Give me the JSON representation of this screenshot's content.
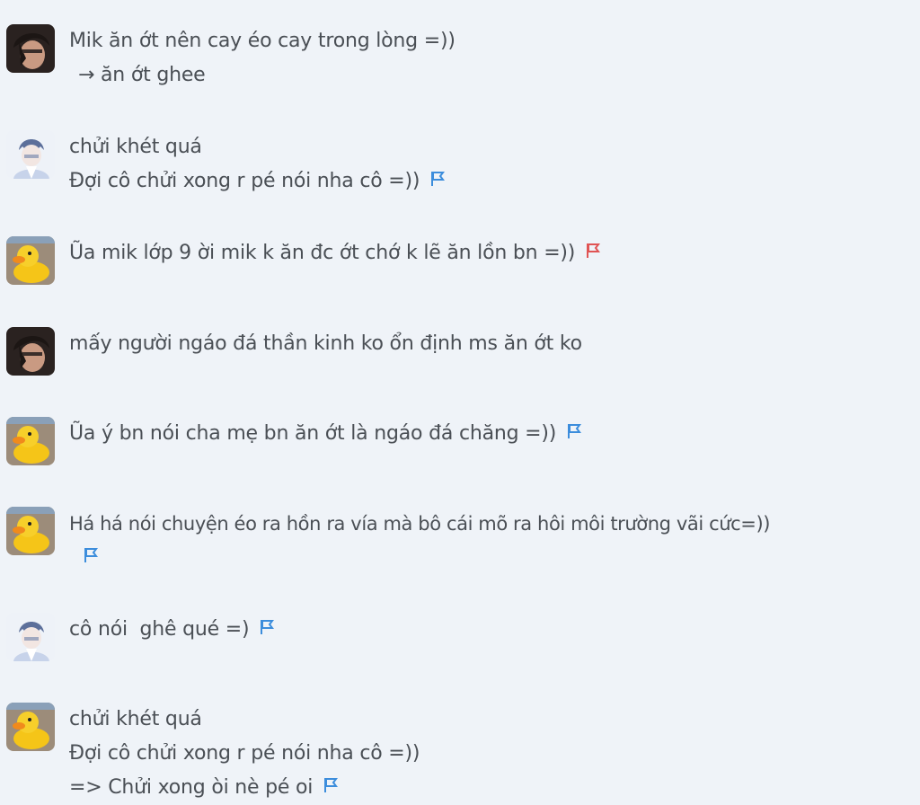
{
  "comments": [
    {
      "avatar": "dark-hair-avatar",
      "lines": [
        "Mik ăn ớt nên cay éo cay trong lòng =))",
        "→  ăn ớt ghee"
      ],
      "flag": null
    },
    {
      "avatar": "anime-boy-avatar",
      "lines": [
        "chửi khét quá",
        "Đợi cô chửi xong r pé nói nha cô =))"
      ],
      "flag": "blue"
    },
    {
      "avatar": "duck-avatar",
      "lines": [
        "Ũa mik lớp 9 ời mik k ăn đc ớt chớ k lẽ ăn lồn bn =))"
      ],
      "flag": "red"
    },
    {
      "avatar": "dark-hair-avatar",
      "lines": [
        "mấy người ngáo đá thần kinh ko ổn định ms ăn ớt ko"
      ],
      "flag": null
    },
    {
      "avatar": "duck-avatar",
      "lines": [
        "Ũa ý bn nói cha mẹ bn ăn ớt là ngáo đá chăng =))"
      ],
      "flag": "blue"
    },
    {
      "avatar": "duck-avatar",
      "lines": [
        "Há há nói chuyện éo ra hồn ra vía mà bô cái mõ ra hôi môi trường vãi cức=))"
      ],
      "flag": "blue"
    },
    {
      "avatar": "anime-boy-avatar",
      "lines": [
        "cô nói  ghê qué =)"
      ],
      "flag": "blue"
    },
    {
      "avatar": "duck-avatar",
      "lines": [
        "chửi khét quá",
        "Đợi cô chửi xong r pé nói nha cô =))",
        "=> Chửi xong òi nè pé oi"
      ],
      "flag": "blue"
    }
  ],
  "colors": {
    "background": "#eff3f8",
    "text": "#4a4f55",
    "flag_blue": "#3c8ddc",
    "flag_red": "#e05454"
  }
}
